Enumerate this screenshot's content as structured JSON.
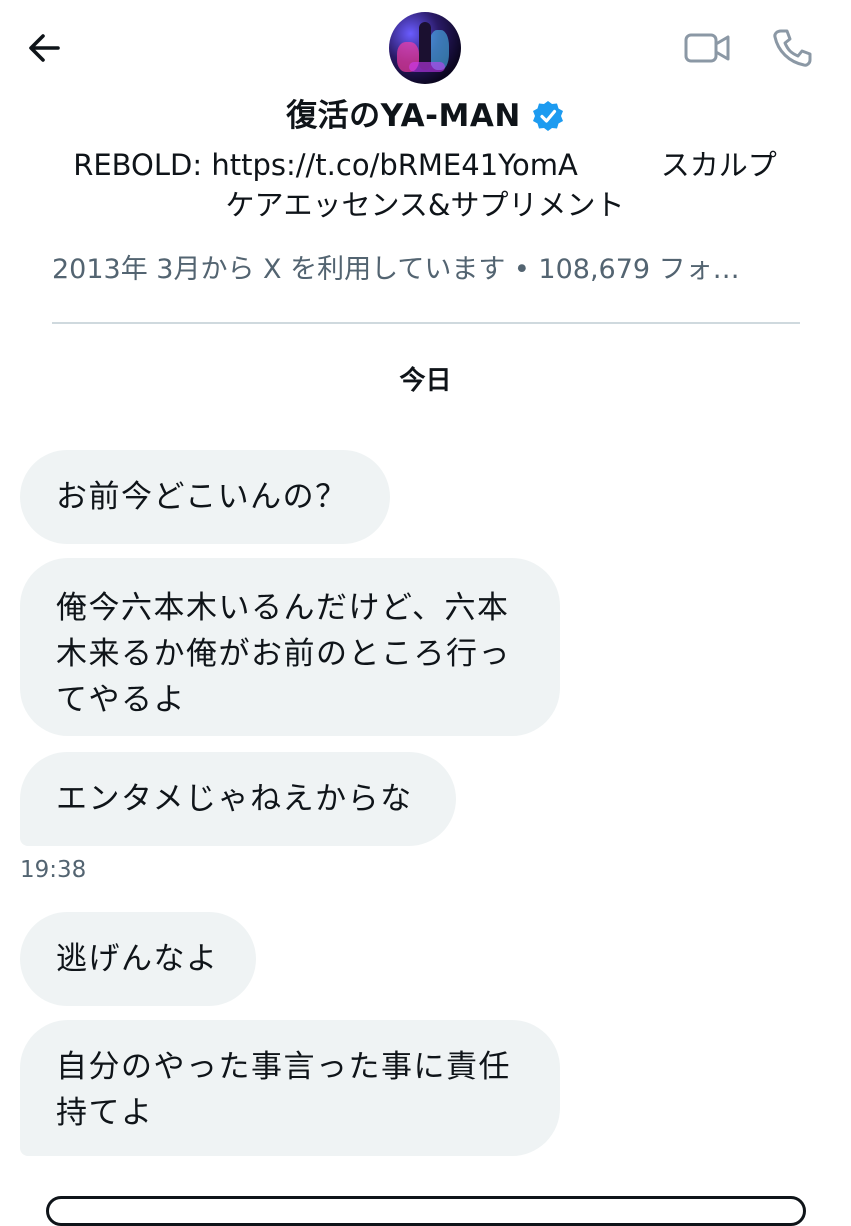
{
  "header": {
    "profile_name": "復活のYA-MAN",
    "verified": true,
    "bio_line1": "REBOLD: https://t.co/bRME41YomA         スカルプ",
    "bio_line2": "ケアエッセンス&サプリメント",
    "meta": "2013年 3月から X を利用しています • 108,679 フォ…",
    "icons": {
      "back": "arrow-left-icon",
      "video": "video-camera-icon",
      "phone": "phone-icon",
      "verified": "verified-badge-icon"
    },
    "accent_color": "#1d9bf0"
  },
  "conversation": {
    "date_separator": "今日",
    "messages": [
      {
        "text": "お前今どこいんの？"
      },
      {
        "text": "俺今六本木いるんだけど、六本\n木来るか俺がお前のところ行っ\nてやるよ"
      },
      {
        "text": "エンタメじゃねえからな"
      },
      {
        "text": "逃げんなよ"
      },
      {
        "text": "自分のやった事言った事に責任\n持てよ"
      }
    ],
    "timestamp": "19:38"
  }
}
